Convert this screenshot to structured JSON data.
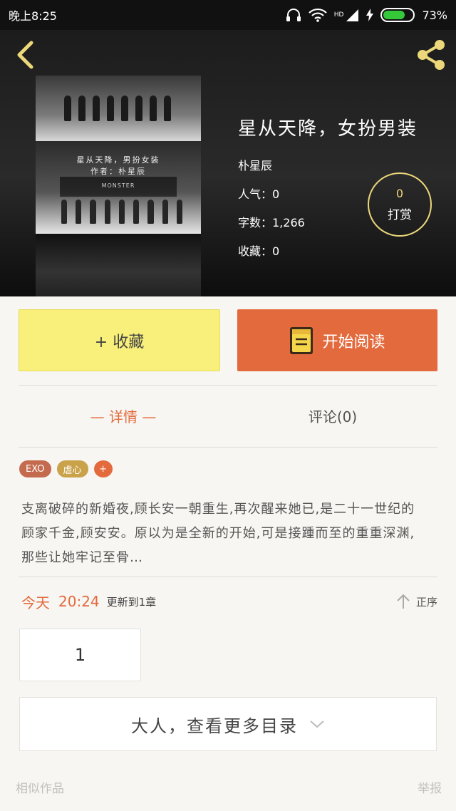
{
  "status_bar": {
    "time": "晚上8:25",
    "network": "HD",
    "battery_text": "73%",
    "battery_level": 0.73
  },
  "book": {
    "title": "星从天降，女扮男装",
    "author": "朴星辰",
    "popularity": "人气：0",
    "word_count": "字数：1,266",
    "favorites": "收藏：0",
    "cover_title": "星从天降，男扮女装",
    "cover_author": "作者：朴星辰",
    "cover_caption": "MONSTER"
  },
  "tip": {
    "count": "0",
    "label": "打赏"
  },
  "actions": {
    "collect_label": "+ 收藏",
    "read_label": "开始阅读"
  },
  "tabs": [
    {
      "label": "— 详情 —"
    },
    {
      "label": "评论(0)"
    }
  ],
  "tags": [
    {
      "label": "EXO"
    },
    {
      "label": "虐心"
    },
    {
      "label": "+"
    }
  ],
  "synopsis": "支离破碎的新婚夜,顾长安一朝重生,再次醒来她已,是二十一世纪的顾家千金,顾安安。原以为是全新的开始,可是接踵而至的重重深渊,那些让她牢记至骨…",
  "update": {
    "day": "今天",
    "time": "20:24",
    "text": "更新到1章",
    "sort_label": "正序"
  },
  "chapters": [
    {
      "label": "1"
    }
  ],
  "more_catalog_label": "大人，查看更多目录",
  "footer": {
    "similar": "相似作品",
    "report": "举报"
  },
  "colors": {
    "accent": "#e36a3d",
    "collect_bg": "#f8f07a",
    "tip_ring": "#ecd77a"
  }
}
